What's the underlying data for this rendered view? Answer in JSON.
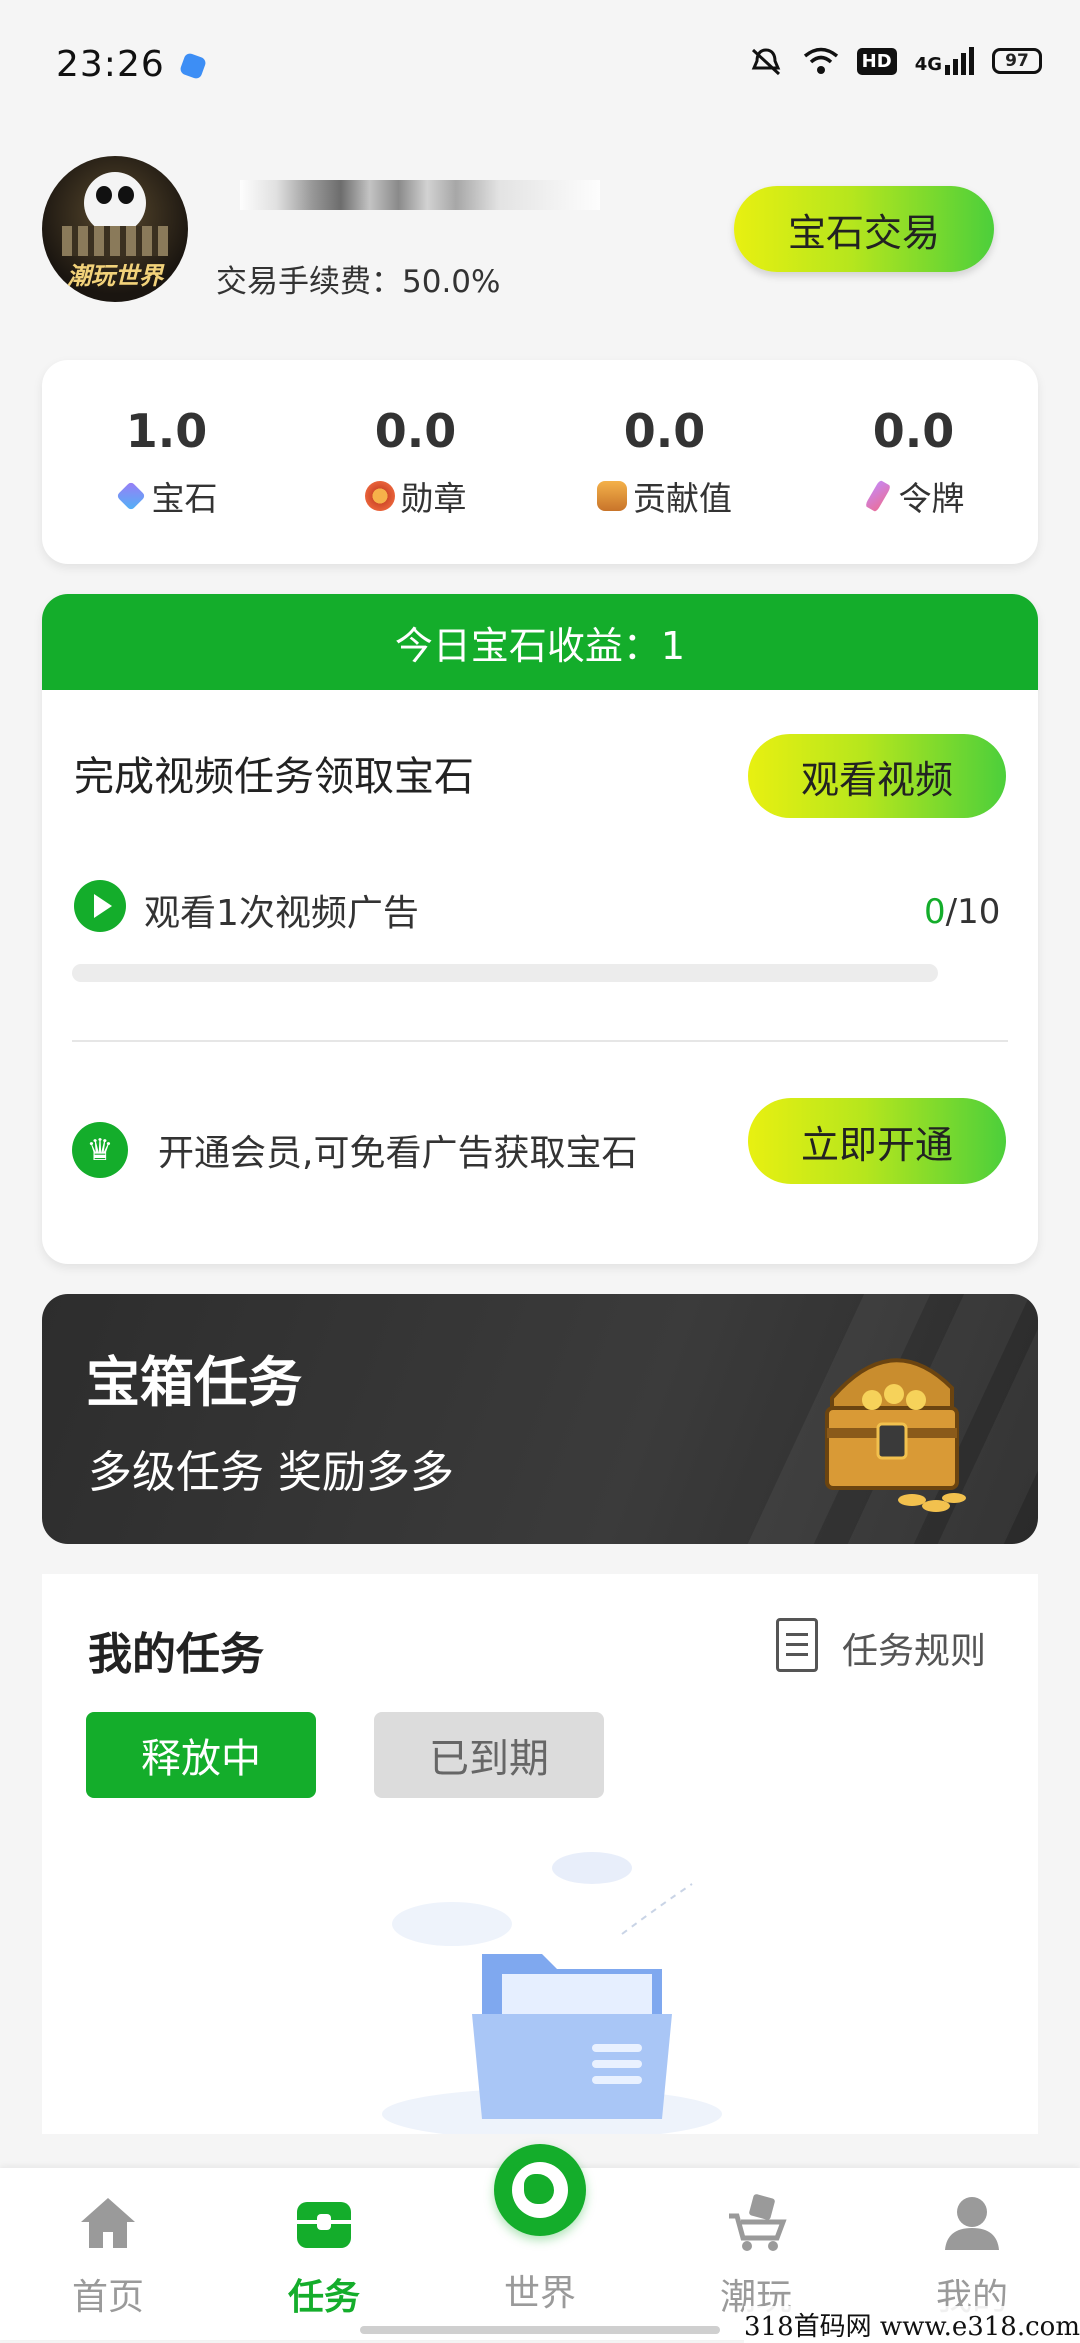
{
  "status_bar": {
    "time": "23:26",
    "network": "4G",
    "hd": "HD",
    "battery": "97"
  },
  "profile": {
    "avatar_logo_text": "潮玩世界",
    "fee_text": "交易手续费：50.0%",
    "gem_trade_label": "宝石交易"
  },
  "stats": [
    {
      "value": "1.0",
      "label": "宝石",
      "icon": "gem-icon"
    },
    {
      "value": "0.0",
      "label": "勋章",
      "icon": "medal-icon"
    },
    {
      "value": "0.0",
      "label": "贡献值",
      "icon": "contribution-icon"
    },
    {
      "value": "0.0",
      "label": "令牌",
      "icon": "token-icon"
    }
  ],
  "video_task": {
    "today_income": "今日宝石收益：1",
    "title": "完成视频任务领取宝石",
    "watch_button": "观看视频",
    "ad_task_label": "观看1次视频广告",
    "progress_done": "0",
    "progress_total": "/10",
    "progress_fraction": 0,
    "vip_text": "开通会员,可免看广告获取宝石",
    "open_button": "立即开通"
  },
  "chest_banner": {
    "title": "宝箱任务",
    "subtitle": "多级任务 奖励多多"
  },
  "my_tasks": {
    "title": "我的任务",
    "rules_label": "任务规则",
    "tab_active": "释放中",
    "tab_inactive": "已到期"
  },
  "nav": [
    {
      "label": "首页",
      "icon": "home-icon"
    },
    {
      "label": "任务",
      "icon": "task-icon",
      "active": true
    },
    {
      "label": "世界",
      "icon": "globe-icon"
    },
    {
      "label": "潮玩",
      "icon": "cart-icon"
    },
    {
      "label": "我的",
      "icon": "person-icon"
    }
  ],
  "watermark": "318首码网 www.e318.com",
  "colors": {
    "accent": "#14ad2b",
    "button_gradient_start": "#e8f011",
    "button_gradient_end": "#4ccf3b"
  }
}
